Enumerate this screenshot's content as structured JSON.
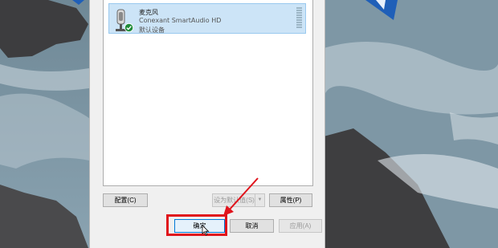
{
  "dialog": {
    "device": {
      "name": "麦克风",
      "driver": "Conexant SmartAudio HD",
      "status": "默认设备",
      "status_icon": "check-icon",
      "device_icon": "microphone-icon"
    },
    "buttons": {
      "configure": "配置(C)",
      "set_default": "设为默认值(S)",
      "properties": "属性(P)",
      "ok": "确定",
      "cancel": "取消",
      "apply": "应用(A)"
    }
  },
  "annotation": {
    "highlight_color": "#e0141c",
    "arrow_color": "#e0141c"
  }
}
